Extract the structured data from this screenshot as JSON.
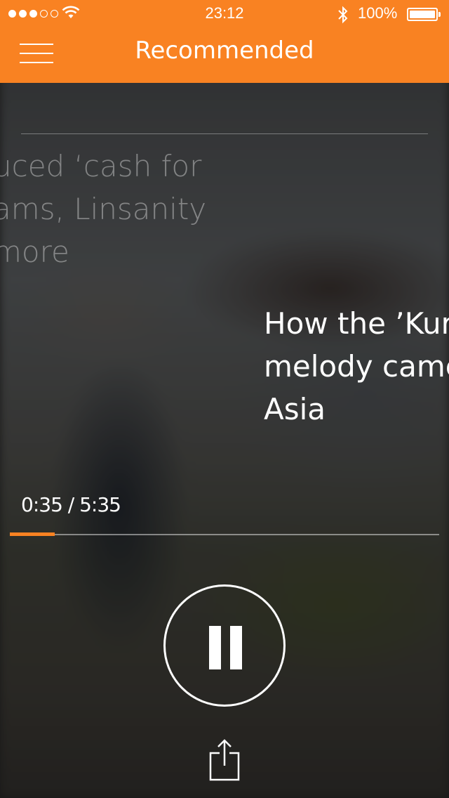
{
  "status_bar": {
    "signal_dots": [
      true,
      true,
      true,
      false,
      false
    ],
    "time": "23:12",
    "battery": "100%",
    "icons": [
      "signal-dots-icon",
      "wifi-icon",
      "bluetooth-icon",
      "battery-icon"
    ]
  },
  "header": {
    "title": "Recommended",
    "menu_icon": "hamburger-menu-icon",
    "background_color": "#f98222"
  },
  "previous_story": {
    "lines": [
      "uced ‘cash for",
      "ams, Linsanity",
      "more"
    ]
  },
  "current_story": {
    "lines": [
      "How the ’Kur",
      "melody came",
      "Asia"
    ]
  },
  "player": {
    "time_readout": "0:35 / 5:35",
    "elapsed_seconds": 35,
    "duration_seconds": 335,
    "progress_color": "#f98222",
    "pause_icon": "pause-icon",
    "share_icon": "share-icon"
  }
}
